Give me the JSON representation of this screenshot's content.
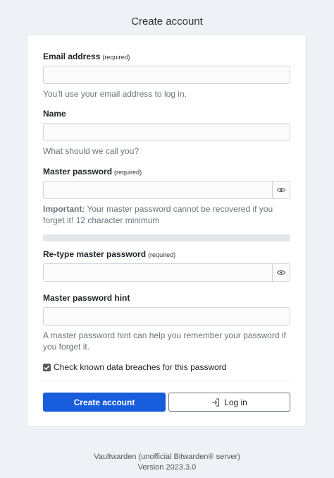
{
  "page": {
    "title": "Create account"
  },
  "form": {
    "email": {
      "label": "Email address",
      "required": "(required)",
      "value": "",
      "help": "You'll use your email address to log in."
    },
    "name": {
      "label": "Name",
      "value": "",
      "help": "What should we call you?"
    },
    "master_password": {
      "label": "Master password",
      "required": "(required)",
      "value": "",
      "help_strong": "Important:",
      "help": " Your master password cannot be recovered if you forget it! 12 character minimum",
      "toggle_icon": "eye-icon"
    },
    "retype_password": {
      "label": "Re-type master password",
      "required": "(required)",
      "value": "",
      "toggle_icon": "eye-icon"
    },
    "hint": {
      "label": "Master password hint",
      "value": "",
      "help": "A master password hint can help you remember your password if you forget it."
    },
    "check_breaches": {
      "label": "Check known data breaches for this password",
      "checked": true
    },
    "create_button": "Create account",
    "login_button": "Log in",
    "login_icon": "sign-in-icon"
  },
  "footer": {
    "line1": "Vaultwarden (unofficial Bitwarden® server)",
    "line2": "Version 2023.3.0"
  },
  "colors": {
    "primary": "#175ddc",
    "background": "#eef1f5"
  }
}
